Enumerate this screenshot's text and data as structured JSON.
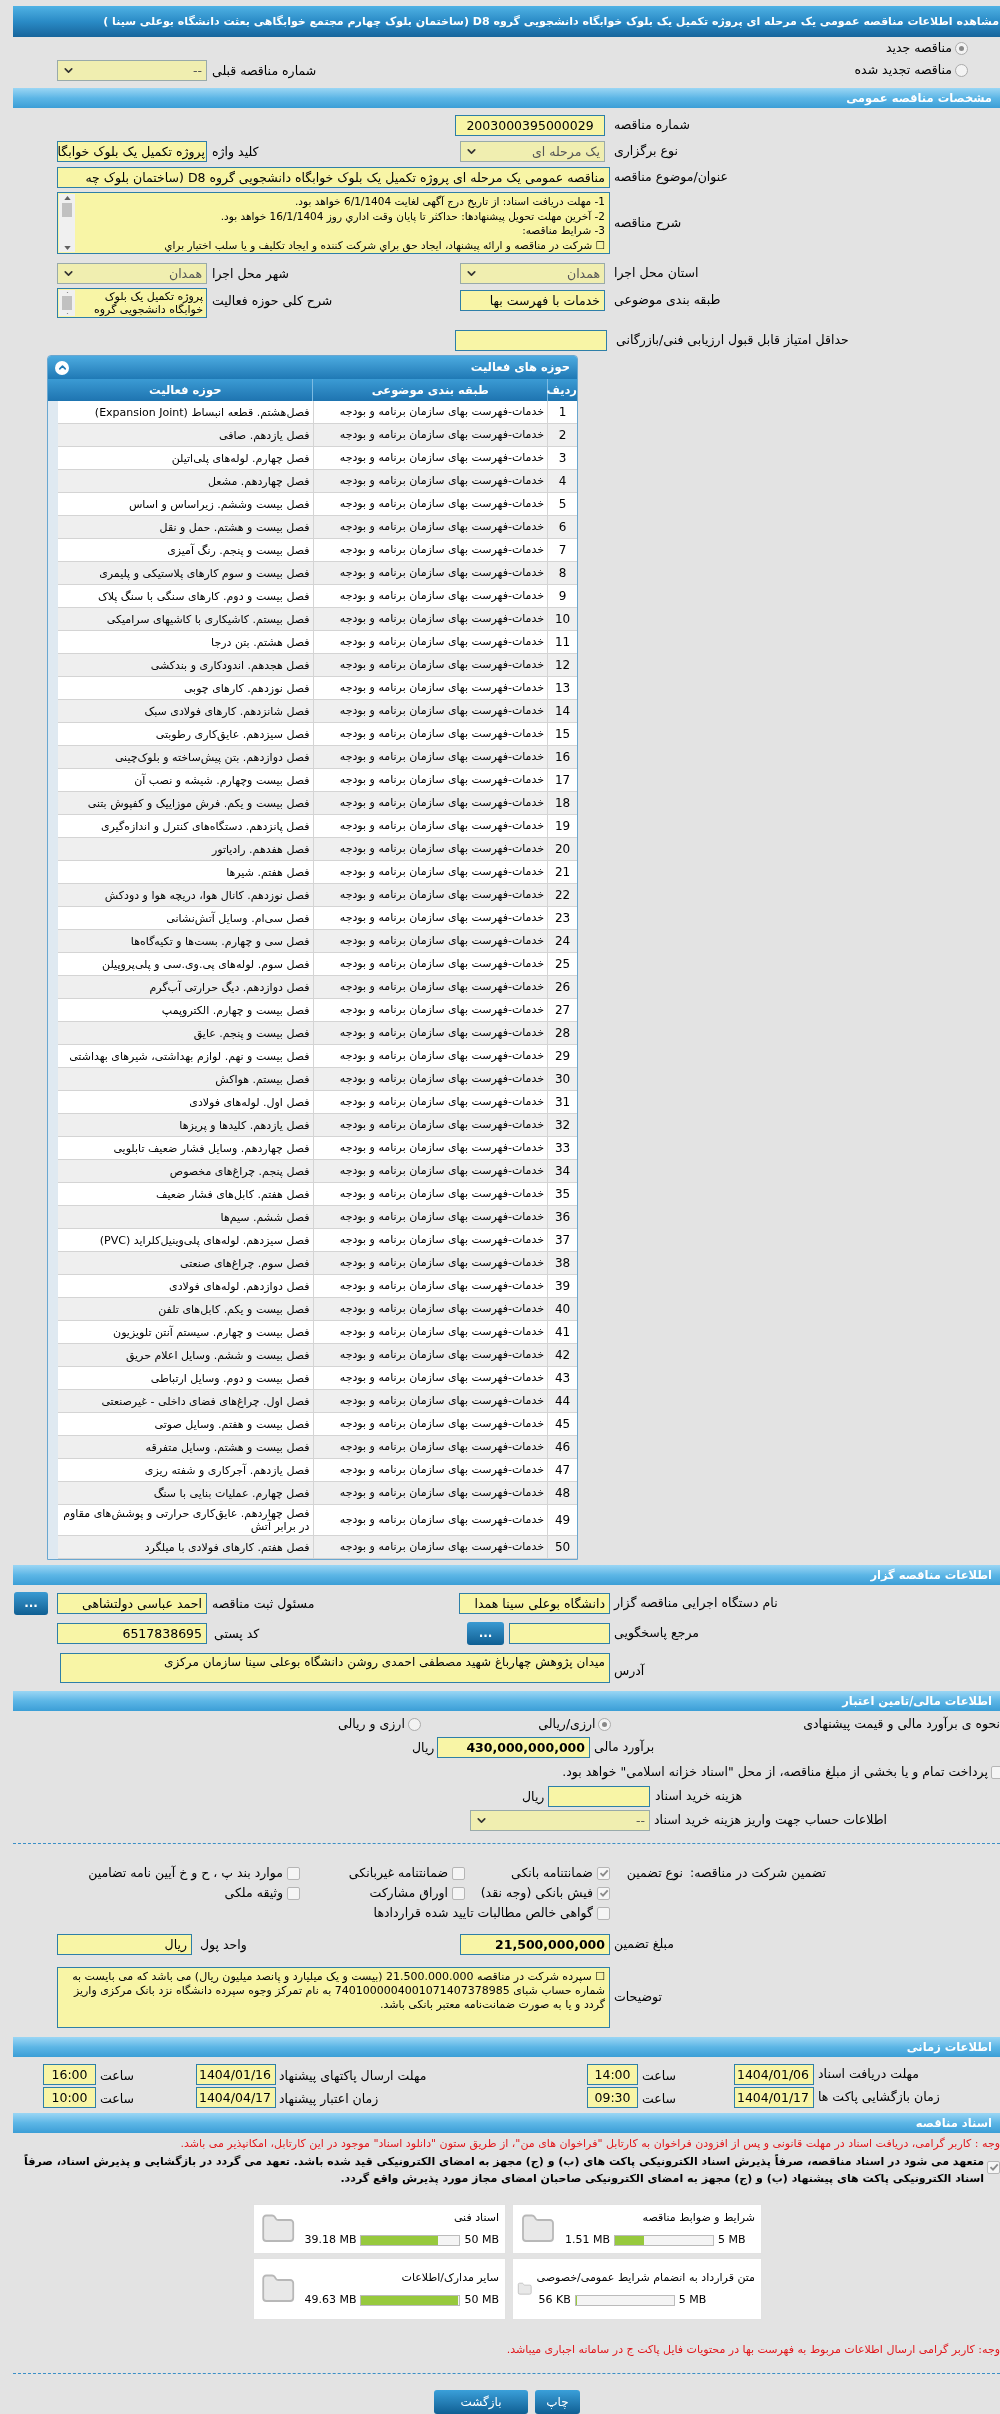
{
  "page_title": "مشاهده اطلاعات مناقصه عمومی یک مرحله ای پروژه تکمیل یک بلوک خوابگاه دانشجویی گروه D8 (ساختمان بلوک چهارم مجتمع خوابگاهی بعثت دانشگاه بوعلی سینا )",
  "tender_status": [
    {
      "label": "مناقصه جدید",
      "selected": true
    },
    {
      "label": "مناقصه تجدید شده",
      "selected": false
    }
  ],
  "previous_tender": {
    "label": "شماره مناقصه قبلی",
    "value": "--"
  },
  "general": {
    "title": "مشخصات مناقصه عمومی",
    "tender_number": {
      "label": "شماره مناقصه",
      "value": "2003000395000029"
    },
    "holding_type": {
      "label": "نوع برگزاری",
      "value": "یک مرحله ای"
    },
    "keyword": {
      "label": "کلید واژه",
      "value": "پروژه تکمیل یک بلوک خوابگا"
    },
    "subject": {
      "label": "عنوان/موضوع مناقصه",
      "value": "مناقصه عمومی یک مرحله ای پروژه تکمیل یک بلوک خوابگاه دانشجویی گروه D8 (ساختمان بلوک چه"
    },
    "description": {
      "label": "شرح مناقصه",
      "lines": [
        "1-    مهلت دریافت اسناد: از تاریخ درج آگهی لغایت 6/1/1404 خواهد بود.",
        "2-    آخرین مهلت تحویل پیشنهادها: حداکثر تا پایان وقت اداري روز 16/1/1404 خواهد بود.",
        "3-    شرایط مناقصه:",
        "☐   شرکت در مناقصه و ارائه پیشنهاد، ایجاد حق براي شرکت کننده و ایجاد تکلیف و یا سلب اختیار براي"
      ]
    },
    "province": {
      "label": "استان محل اجرا",
      "value": "همدان"
    },
    "city": {
      "label": "شهر محل اجرا",
      "value": "همدان"
    },
    "category": {
      "label": "طبقه بندی موضوعی",
      "value": "خدمات با فهرست بها"
    },
    "activity_summary": {
      "label": "شرح کلی حوزه فعالیت",
      "value": "پروژه تکمیل یک بلوک خوابگاه دانشجویی گروه"
    },
    "min_score": {
      "label": "حداقل امتیاز قابل قبول ارزیابی فنی/بازرگانی"
    }
  },
  "activities": {
    "title": "حوزه های فعالیت",
    "columns": [
      "ردیف",
      "طبقه بندی موضوعی",
      "حوزه فعالیت"
    ],
    "rows": [
      {
        "index": "1",
        "category": "خدمات-فهرست بهای سازمان برنامه و بودجه",
        "activity": "فصل‌هشتم. قطعه انبساط (Expansion Joint)"
      },
      {
        "index": "2",
        "category": "خدمات-فهرست بهای سازمان برنامه و بودجه",
        "activity": "فصل یازدهم. صافی"
      },
      {
        "index": "3",
        "category": "خدمات-فهرست بهای سازمان برنامه و بودجه",
        "activity": "فصل چهارم. لوله‌های پلی‌اتیلن"
      },
      {
        "index": "4",
        "category": "خدمات-فهرست بهای سازمان برنامه و بودجه",
        "activity": "فصل چهاردهم. مشعل"
      },
      {
        "index": "5",
        "category": "خدمات-فهرست بهای سازمان برنامه و بودجه",
        "activity": "فصل بیست وششم. زیراساس و اساس"
      },
      {
        "index": "6",
        "category": "خدمات-فهرست بهای سازمان برنامه و بودجه",
        "activity": "فصل بیست و هشتم. حمل و نقل"
      },
      {
        "index": "7",
        "category": "خدمات-فهرست بهای سازمان برنامه و بودجه",
        "activity": "فصل بیست و پنجم. رنگ آمیزی"
      },
      {
        "index": "8",
        "category": "خدمات-فهرست بهای سازمان برنامه و بودجه",
        "activity": "فصل بیست و سوم کارهای پلاستیکی و پلیمری"
      },
      {
        "index": "9",
        "category": "خدمات-فهرست بهای سازمان برنامه و بودجه",
        "activity": "فصل بیست و دوم. کارهای سنگی با سنگ پلاک"
      },
      {
        "index": "10",
        "category": "خدمات-فهرست بهای سازمان برنامه و بودجه",
        "activity": "فصل بیستم. کاشیکاری با کاشیهای سرامیکی"
      },
      {
        "index": "11",
        "category": "خدمات-فهرست بهای سازمان برنامه و بودجه",
        "activity": "فصل هشتم. بتن درجا"
      },
      {
        "index": "12",
        "category": "خدمات-فهرست بهای سازمان برنامه و بودجه",
        "activity": "فصل هجدهم. اندودکاری و بندکشی"
      },
      {
        "index": "13",
        "category": "خدمات-فهرست بهای سازمان برنامه و بودجه",
        "activity": "فصل نوزدهم. کارهای چوبی"
      },
      {
        "index": "14",
        "category": "خدمات-فهرست بهای سازمان برنامه و بودجه",
        "activity": "فصل شانزدهم. کارهای فولادی سبک"
      },
      {
        "index": "15",
        "category": "خدمات-فهرست بهای سازمان برنامه و بودجه",
        "activity": "فصل سیزدهم. عایق‌کاری رطوبتی"
      },
      {
        "index": "16",
        "category": "خدمات-فهرست بهای سازمان برنامه و بودجه",
        "activity": "فصل دوازدهم. بتن پیش‌ساخته و بلوک‌چینی"
      },
      {
        "index": "17",
        "category": "خدمات-فهرست بهای سازمان برنامه و بودجه",
        "activity": "فصل بیست وچهارم. شیشه و نصب آن"
      },
      {
        "index": "18",
        "category": "خدمات-فهرست بهای سازمان برنامه و بودجه",
        "activity": "فصل بیست و یکم. فرش موزاییک و کفپوش بتنی"
      },
      {
        "index": "19",
        "category": "خدمات-فهرست بهای سازمان برنامه و بودجه",
        "activity": "فصل پانزدهم. دستگاه‌های کنترل و اندازه‌گیری"
      },
      {
        "index": "20",
        "category": "خدمات-فهرست بهای سازمان برنامه و بودجه",
        "activity": "فصل هفدهم. رادیاتور"
      },
      {
        "index": "21",
        "category": "خدمات-فهرست بهای سازمان برنامه و بودجه",
        "activity": "فصل هفتم. شیرها"
      },
      {
        "index": "22",
        "category": "خدمات-فهرست بهای سازمان برنامه و بودجه",
        "activity": "فصل نوزدهم. کانال هوا، دریچه هوا و دودکش"
      },
      {
        "index": "23",
        "category": "خدمات-فهرست بهای سازمان برنامه و بودجه",
        "activity": "فصل سی‌ام. وسایل آتش‌نشانی"
      },
      {
        "index": "24",
        "category": "خدمات-فهرست بهای سازمان برنامه و بودجه",
        "activity": "فصل سی و چهارم. بست‌ها و تکیه‌گاه‌ها"
      },
      {
        "index": "25",
        "category": "خدمات-فهرست بهای سازمان برنامه و بودجه",
        "activity": "فصل سوم. لوله‌های پی.وی.سی و پلی‌پروپیلن"
      },
      {
        "index": "26",
        "category": "خدمات-فهرست بهای سازمان برنامه و بودجه",
        "activity": "فصل دوازدهم. دیگ حرارتی آب‌گرم"
      },
      {
        "index": "27",
        "category": "خدمات-فهرست بهای سازمان برنامه و بودجه",
        "activity": "فصل بیست و چهارم. الکتروپمپ"
      },
      {
        "index": "28",
        "category": "خدمات-فهرست بهای سازمان برنامه و بودجه",
        "activity": "فصل بیست و پنجم. عایق"
      },
      {
        "index": "29",
        "category": "خدمات-فهرست بهای سازمان برنامه و بودجه",
        "activity": "فصل بیست و نهم. لوازم بهداشتی، شیرهای بهداشتی"
      },
      {
        "index": "30",
        "category": "خدمات-فهرست بهای سازمان برنامه و بودجه",
        "activity": "فصل بیستم. هواکش"
      },
      {
        "index": "31",
        "category": "خدمات-فهرست بهای سازمان برنامه و بودجه",
        "activity": "فصل اول. لوله‌های فولادی"
      },
      {
        "index": "32",
        "category": "خدمات-فهرست بهای سازمان برنامه و بودجه",
        "activity": "فصل یازدهم. کلیدها و پریزها"
      },
      {
        "index": "33",
        "category": "خدمات-فهرست بهای سازمان برنامه و بودجه",
        "activity": "فصل چهاردهم. وسایل فشار ضعیف تابلویی"
      },
      {
        "index": "34",
        "category": "خدمات-فهرست بهای سازمان برنامه و بودجه",
        "activity": "فصل پنجم. چراغ‌های مخصوص"
      },
      {
        "index": "35",
        "category": "خدمات-فهرست بهای سازمان برنامه و بودجه",
        "activity": "فصل هفتم. کابل‌های فشار ضعیف"
      },
      {
        "index": "36",
        "category": "خدمات-فهرست بهای سازمان برنامه و بودجه",
        "activity": "فصل ششم. سیم‌ها"
      },
      {
        "index": "37",
        "category": "خدمات-فهرست بهای سازمان برنامه و بودجه",
        "activity": "فصل سیزدهم. لوله‌های پلی‌وینیل‌کلراید (PVC)"
      },
      {
        "index": "38",
        "category": "خدمات-فهرست بهای سازمان برنامه و بودجه",
        "activity": "فصل سوم. چراغ‌های صنعتی"
      },
      {
        "index": "39",
        "category": "خدمات-فهرست بهای سازمان برنامه و بودجه",
        "activity": "فصل دوازدهم. لوله‌های فولادی"
      },
      {
        "index": "40",
        "category": "خدمات-فهرست بهای سازمان برنامه و بودجه",
        "activity": "فصل بیست و یکم. کابل‌های تلفن"
      },
      {
        "index": "41",
        "category": "خدمات-فهرست بهای سازمان برنامه و بودجه",
        "activity": "فصل بیست و چهارم. سیستم آنتن تلویزیون"
      },
      {
        "index": "42",
        "category": "خدمات-فهرست بهای سازمان برنامه و بودجه",
        "activity": "فصل بیست و ششم. وسایل اعلام حریق"
      },
      {
        "index": "43",
        "category": "خدمات-فهرست بهای سازمان برنامه و بودجه",
        "activity": "فصل بیست و دوم. وسایل ارتباطی"
      },
      {
        "index": "44",
        "category": "خدمات-فهرست بهای سازمان برنامه و بودجه",
        "activity": "فصل اول. چراغ‌های فضای داخلی - غیرصنعتی"
      },
      {
        "index": "45",
        "category": "خدمات-فهرست بهای سازمان برنامه و بودجه",
        "activity": "فصل بیست و هفتم. وسایل صوتی"
      },
      {
        "index": "46",
        "category": "خدمات-فهرست بهای سازمان برنامه و بودجه",
        "activity": "فصل بیست و هشتم. وسایل متفرقه"
      },
      {
        "index": "47",
        "category": "خدمات-فهرست بهای سازمان برنامه و بودجه",
        "activity": "فصل یازدهم. آجرکاری و شفته ریزی"
      },
      {
        "index": "48",
        "category": "خدمات-فهرست بهای سازمان برنامه و بودجه",
        "activity": "فصل چهارم. عملیات بنایی با سنگ"
      },
      {
        "index": "49",
        "category": "خدمات-فهرست بهای سازمان برنامه و بودجه",
        "activity": "فصل چهاردهم. عایق‌کاری حرارتی و پوشش‌های مقاوم در برابر آتش"
      },
      {
        "index": "50",
        "category": "خدمات-فهرست بهای سازمان برنامه و بودجه",
        "activity": "فصل هفتم. کارهای فولادی با میلگرد"
      }
    ]
  },
  "organizer": {
    "title": "اطلاعات مناقصه گزار",
    "agency": {
      "label": "نام دستگاه اجرایی مناقصه گزار",
      "value": "دانشگاه بوعلی سینا همدا"
    },
    "registrar": {
      "label": "مسئول ثبت مناقصه",
      "value": "احمد عباسی دولتشاهی",
      "button": "..."
    },
    "contact": {
      "label": "مرجع پاسخگویی",
      "button": "..."
    },
    "postal_code": {
      "label": "کد پستی",
      "value": "6517838695"
    },
    "address": {
      "label": "آدرس",
      "value": "میدان  پژوهش چهارباغ شهید مصطفی احمدی روشن دانشگاه بوعلی سینا سازمان مرکزی"
    }
  },
  "financial": {
    "title": "اطلاعات مالی/تامین اعتبار",
    "estimate_method": {
      "label": "نحوه ی برآورد مالی و قیمت پیشنهادی",
      "options": [
        {
          "label": "ارزی/ریالی",
          "selected": true
        },
        {
          "label": "ارزی و ریالی",
          "selected": false
        }
      ]
    },
    "estimate": {
      "label": "برآورد مالی",
      "value": "430,000,000,000",
      "unit": "ریال"
    },
    "treasury": {
      "label": "پرداخت تمام و یا بخشی از مبلغ مناقصه، از محل \"اسناد خزانه اسلامی\" خواهد بود.",
      "checked": false
    },
    "doc_fee": {
      "label": "هزینه خرید اسناد",
      "unit": "ریال"
    },
    "fee_account": {
      "label": "اطلاعات حساب جهت واریز هزینه خرید اسناد",
      "value": "--"
    },
    "guarantee": {
      "label": "تضمین شرکت در مناقصه:",
      "type_label": "نوع تضمین",
      "options": [
        {
          "label": "ضمانتنامه بانکی",
          "checked": true
        },
        {
          "label": "ضمانتنامه غیربانکی",
          "checked": false
        },
        {
          "label": "موارد بند پ ، ح و خ آیین نامه تضامین",
          "checked": false
        },
        {
          "label": "فیش بانکی (وجه نقد)",
          "checked": true
        },
        {
          "label": "اوراق مشارکت",
          "checked": false
        },
        {
          "label": "وثیقه ملکی",
          "checked": false
        },
        {
          "label": "گواهی خالص مطالبات تایید شده قراردادها",
          "checked": false
        }
      ]
    },
    "guarantee_amount": {
      "label": "مبلغ تضمین",
      "value": "21,500,000,000"
    },
    "currency": {
      "label": "واحد پول",
      "value": "ریال"
    },
    "notes": {
      "label": "توضیحات",
      "value": "☐   سپرده شرکت در مناقصه 21.500.000.000 (بیست و یک میلیارد و پانصد میلیون ریال) می باشد که می بایست به شماره حساب شبای 7401000004001071407378985 به نام تمرکز وجوه سپرده دانشگاه نزد بانک مرکزی واریز گردد و یا به صورت ضمانت‌نامه معتبر بانکی باشد."
    }
  },
  "timing": {
    "title": "اطلاعات زمانی",
    "items": [
      {
        "label": "مهلت دریافت اسناد",
        "date": "1404/01/06",
        "time_label": "ساعت",
        "time": "14:00"
      },
      {
        "label": "مهلت ارسال پاکتهای پیشنهاد",
        "date": "1404/01/16",
        "time_label": "ساعت",
        "time": "16:00"
      },
      {
        "label": "زمان بازگشایی پاکت ها",
        "date": "1404/01/17",
        "time_label": "ساعت",
        "time": "09:30"
      },
      {
        "label": "زمان اعتبار پیشنهاد",
        "date": "1404/04/17",
        "time_label": "ساعت",
        "time": "10:00"
      }
    ]
  },
  "documents": {
    "title": "اسناد مناقصه",
    "notice": "وجه : کاربر گرامی، دریافت اسناد در مهلت قانونی و پس از افزودن فراخوان به کارتابل \"فراخوان های من\"، از طریق ستون \"دانلود اسناد\" موجود در این کارتابل، امکانپذیر می باشد.",
    "commitment": {
      "checked": true,
      "text": "متعهد می شود در اسناد مناقصه، صرفاً پذیرش اسناد الکترونیکی پاکت های (ب) و (ج) مجهز به امضای الکترونیکی قید شده باشد. تعهد می گردد در بازگشایی و پذیرش اسناد، صرفاً اسناد الکترونیکی پاکت های پیشنهاد (ب) و (ج) مجهز به امضای الکترونیکی صاحبان امضای مجاز مورد پذیرش واقع گردد."
    },
    "files": [
      {
        "name": "شرایط و ضوابط مناقصه",
        "used": "1.51 MB",
        "max": "5 MB",
        "level": 0.3
      },
      {
        "name": "اسناد فنی",
        "used": "39.18 MB",
        "max": "50 MB",
        "level": 0.78
      },
      {
        "name": "متن قرارداد به انضمام شرایط عمومی/خصوصی",
        "used": "56 KB",
        "max": "5 MB",
        "level": 0.01
      },
      {
        "name": "سایر مدارک/اطلاعات",
        "used": "49.63 MB",
        "max": "50 MB",
        "level": 0.99
      }
    ],
    "footer_notice": "وجه: کاربر گرامی ارسال اطلاعات مربوط به فهرست بها در محتویات فایل پاکت ج در سامانه اجباری میباشد."
  },
  "buttons": [
    {
      "label": "چاپ"
    },
    {
      "label": "بازگشت"
    }
  ]
}
